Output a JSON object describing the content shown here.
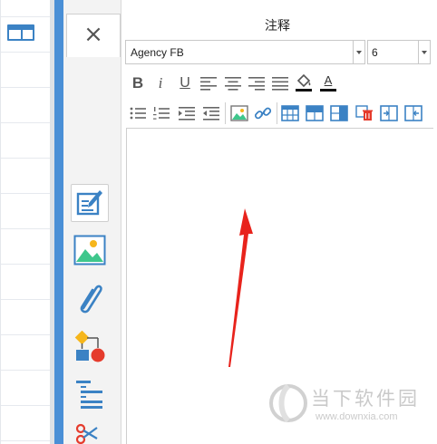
{
  "panel": {
    "title": "注释",
    "close_icon": "×"
  },
  "format": {
    "font_family": "Agency FB",
    "font_size": "6"
  },
  "toolbar_row1": {
    "bold": "B",
    "italic": "i",
    "underline": "U",
    "font_color_label": "A"
  },
  "sidebar_tools": [
    "note-edit-icon",
    "image-icon",
    "paperclip-icon",
    "shapes-icon",
    "outline-list-icon",
    "scissors-icon"
  ],
  "annotation": {
    "arrow_color": "#e8231c"
  },
  "watermark": {
    "brand": "当下软件园",
    "url": "www.downxia.com"
  },
  "colors": {
    "accent_blue": "#4a8fd6",
    "icon_blue": "#3b82c4",
    "red": "#e53b2c"
  }
}
